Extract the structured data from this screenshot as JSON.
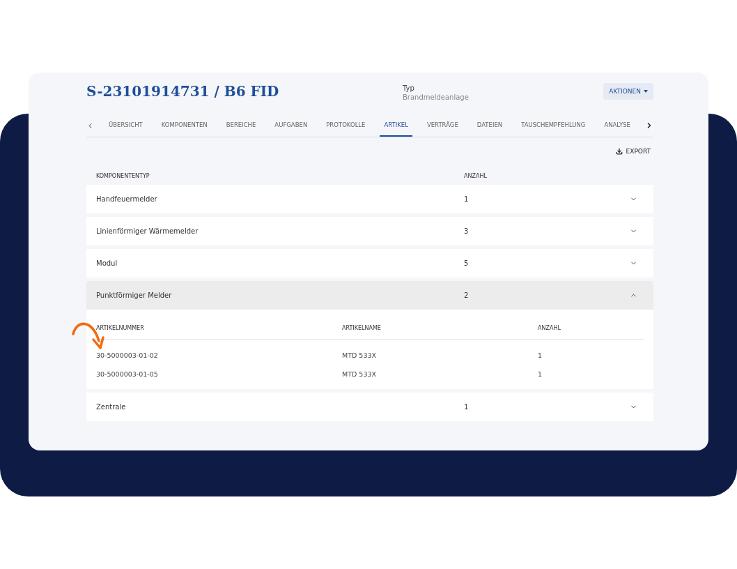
{
  "header": {
    "title": "S-23101914731 / B6 FID",
    "type_label": "Typ",
    "type_value": "Brandmeldeanlage",
    "actions_button": "AKTIONEN"
  },
  "tabs": [
    {
      "label": "ÜBERSICHT",
      "selected": false
    },
    {
      "label": "KOMPONENTEN",
      "selected": false
    },
    {
      "label": "BEREICHE",
      "selected": false
    },
    {
      "label": "AUFGABEN",
      "selected": false
    },
    {
      "label": "PROTOKOLLE",
      "selected": false
    },
    {
      "label": "ARTIKEL",
      "selected": true
    },
    {
      "label": "VERTRÄGE",
      "selected": false
    },
    {
      "label": "DATEIEN",
      "selected": false
    },
    {
      "label": "TAUSCHEMPFEHLUNG",
      "selected": false
    },
    {
      "label": "ANALYSE",
      "selected": false
    }
  ],
  "export_button": "EXPORT",
  "table": {
    "columns": [
      "KOMPONENTENTYP",
      "ANZAHL"
    ],
    "rows": [
      {
        "type": "Handfeuermelder",
        "count": "1",
        "expanded": false
      },
      {
        "type": "Linienförmiger Wärmemelder",
        "count": "3",
        "expanded": false
      },
      {
        "type": "Modul",
        "count": "5",
        "expanded": false
      },
      {
        "type": "Punktförmiger Melder",
        "count": "2",
        "expanded": true,
        "sub_columns": [
          "ARTIKELNUMMER",
          "ARTIKELNAME",
          "ANZAHL"
        ],
        "articles": [
          [
            "30-5000003-01-02",
            "MTD 533X",
            "1"
          ],
          [
            "30-5000003-01-05",
            "MTD 533X",
            "1"
          ]
        ]
      },
      {
        "type": "Zentrale",
        "count": "1",
        "expanded": false
      }
    ]
  }
}
